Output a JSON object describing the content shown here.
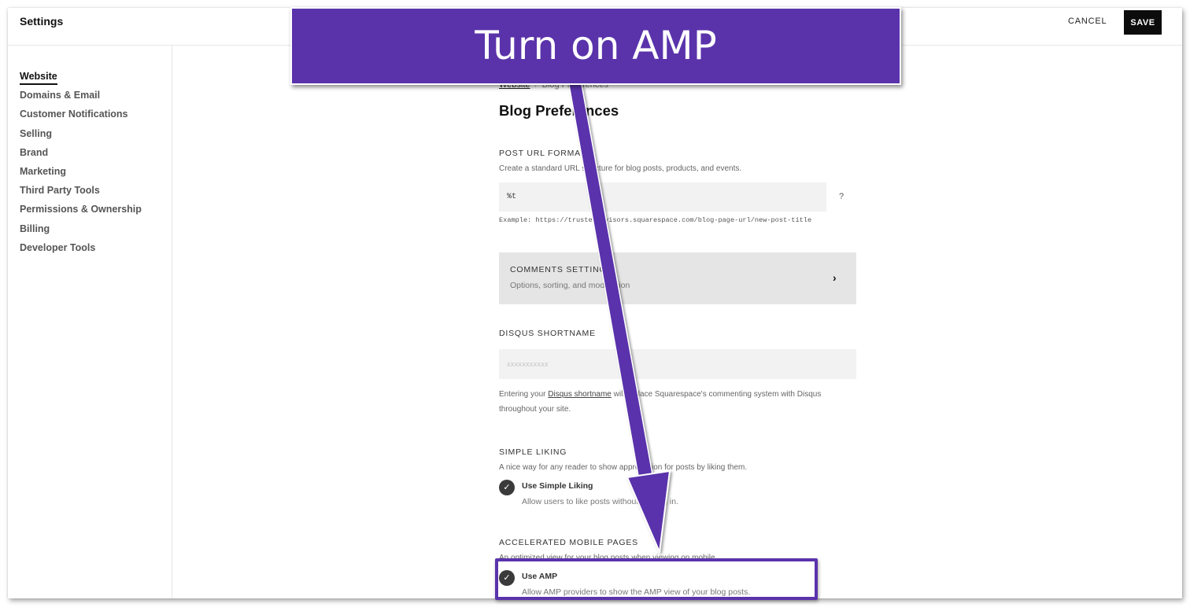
{
  "window": {
    "title": "Settings",
    "cancel_label": "CANCEL",
    "save_label": "SAVE"
  },
  "sidebar": {
    "items": [
      {
        "label": "Website",
        "active": true
      },
      {
        "label": "Domains & Email"
      },
      {
        "label": "Customer Notifications"
      },
      {
        "label": "Selling"
      },
      {
        "label": "Brand"
      },
      {
        "label": "Marketing"
      },
      {
        "label": "Third Party Tools"
      },
      {
        "label": "Permissions & Ownership"
      },
      {
        "label": "Billing"
      },
      {
        "label": "Developer Tools"
      }
    ]
  },
  "main": {
    "breadcrumb": {
      "parent": "Website",
      "separator": "/",
      "current": "Blog Preferences"
    },
    "page_title": "Blog Preferences",
    "post_url": {
      "label": "POST URL FORMAT",
      "description": "Create a standard URL structure for blog posts, products, and events.",
      "value": "%t",
      "help": "?",
      "example": "Example: https://trustedadvisors.squarespace.com/blog-page-url/new-post-title"
    },
    "comments": {
      "title": "COMMENTS SETTINGS",
      "subtitle": "Options, sorting, and moderation",
      "chevron": "›"
    },
    "disqus": {
      "label": "DISQUS SHORTNAME",
      "placeholder": "xxxxxxxxxxx",
      "value": "",
      "note_prefix": "Entering your ",
      "note_link": "Disqus shortname",
      "note_suffix": " will replace Squarespace's commenting system with Disqus throughout your site."
    },
    "simple_liking": {
      "label": "SIMPLE LIKING",
      "description": "A nice way for any reader to show appreciation for posts by liking them.",
      "option_title": "Use Simple Liking",
      "option_desc": "Allow users to like posts without logging in.",
      "checked": true,
      "check_glyph": "✓"
    },
    "amp": {
      "label": "ACCELERATED MOBILE PAGES",
      "description": "An optimized view for your blog posts when viewing on mobile.",
      "option_title": "Use AMP",
      "option_desc": "Allow AMP providers to show the AMP view of your blog posts.",
      "checked": true,
      "check_glyph": "✓"
    }
  },
  "annotation": {
    "banner_text": "Turn on AMP",
    "accent_color": "#5a33ab"
  }
}
